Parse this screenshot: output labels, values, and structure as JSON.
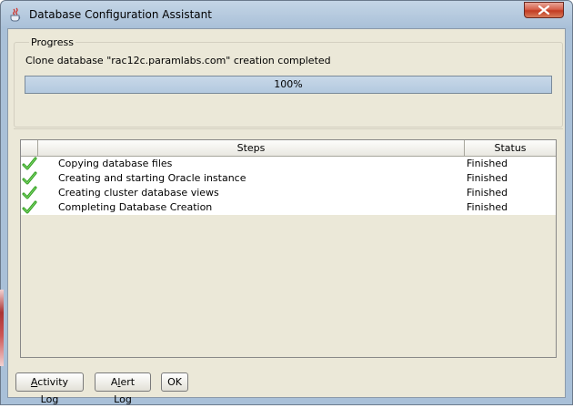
{
  "window": {
    "title": "Database Configuration Assistant",
    "icon": "java-coffee-cup-icon"
  },
  "progress": {
    "group_label": "Progress",
    "message": "Clone database \"rac12c.paramlabs.com\" creation completed",
    "percent": 100,
    "percent_label": "100%"
  },
  "steps_table": {
    "columns": [
      "Steps",
      "Status"
    ],
    "rows": [
      {
        "icon": "green-check-icon",
        "step": "Copying database files",
        "status": "Finished"
      },
      {
        "icon": "green-check-icon",
        "step": "Creating and starting Oracle instance",
        "status": "Finished"
      },
      {
        "icon": "green-check-icon",
        "step": "Creating cluster database views",
        "status": "Finished"
      },
      {
        "icon": "green-check-icon",
        "step": "Completing Database Creation",
        "status": "Finished"
      }
    ]
  },
  "buttons": {
    "activity_mnemonic": "A",
    "activity_rest": "ctivity Log",
    "alert_first": "A",
    "alert_mnemonic": "l",
    "alert_rest": "ert Log",
    "ok": "OK"
  },
  "colors": {
    "check_green": "#2e9e1e",
    "progress_fill": "#b3c9df",
    "close_red": "#c23b22"
  }
}
